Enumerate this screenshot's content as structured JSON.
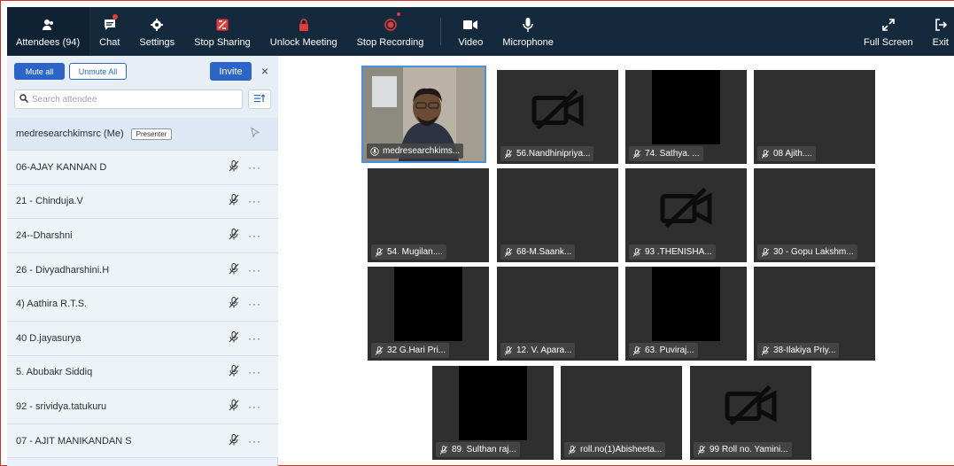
{
  "toolbar": {
    "attendees_label": "Attendees (94)",
    "chat_label": "Chat",
    "settings_label": "Settings",
    "stop_sharing_label": "Stop Sharing",
    "unlock_meeting_label": "Unlock Meeting",
    "stop_recording_label": "Stop Recording",
    "video_label": "Video",
    "microphone_label": "Microphone",
    "full_screen_label": "Full Screen",
    "exit_label": "Exit"
  },
  "panel": {
    "mute_all_label": "Mute all",
    "unmute_all_label": "Unmute All",
    "invite_label": "Invite",
    "close_glyph": "×",
    "search_placeholder": "Search attendee",
    "me": {
      "name": "medresearchkimsrc (Me)",
      "badge": "Presenter"
    },
    "attendees": [
      "06-AJAY KANNAN D",
      "21 - Chinduja.V",
      "24--Dharshni",
      "26 - Divyadharshini.H",
      "4) Aathira R.T.S.",
      "40 D.jayasurya",
      "5. Abubakr Siddiq",
      "92 - srividya.tatukuru",
      "07 - AJIT MANIKANDAN S"
    ],
    "more_glyph": "···"
  },
  "tiles": {
    "t0": "medresearchkims...",
    "t1": "56.Nandhinipriya...",
    "t2": "74. Sathya. ...",
    "t3": "08 Ajith....",
    "t4": "54. Mugilan....",
    "t5": "68-M.Saank...",
    "t6": "93 .THENISHA...",
    "t7": "30 - Gopu Lakshm...",
    "t8": "32 G.Hari Pri...",
    "t9": "12. V. Apara...",
    "t10": "63. Puviraj...",
    "t11": "38-Ilakiya Priy...",
    "t12": "89. Sulthan raj...",
    "t13": "roll.no(1)Abisheeta...",
    "t14": "99 Roll no. Yamini..."
  },
  "colors": {
    "toolbar_bg": "#142a3c",
    "accent_blue": "#2c64c7",
    "alert_red": "#e23b3b",
    "tile_bg": "#2f2f2f",
    "panel_bg": "#eaf1f8"
  },
  "icons": {
    "attendees": "people-icon",
    "chat": "chat-icon",
    "settings": "gear-icon",
    "stop_sharing": "stop-share-icon",
    "unlock": "lock-icon",
    "record": "record-icon",
    "video": "video-camera-icon",
    "microphone": "microphone-icon",
    "full_screen": "expand-icon",
    "exit": "exit-icon"
  }
}
